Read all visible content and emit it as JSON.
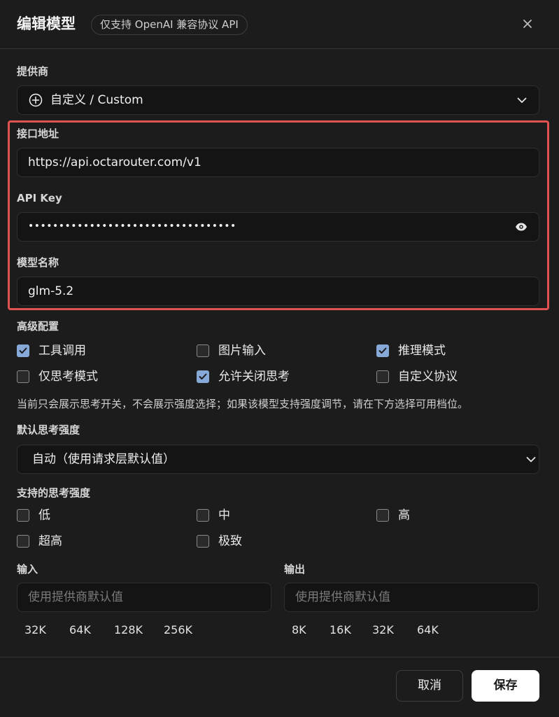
{
  "dialog": {
    "title": "编辑模型",
    "subtitle": "仅支持 OpenAI 兼容协议 API"
  },
  "provider": {
    "label": "提供商",
    "value": "自定义 / Custom"
  },
  "endpoint": {
    "label": "接口地址",
    "value": "https://api.octarouter.com/v1"
  },
  "api_key": {
    "label": "API Key",
    "masked_value": "••••••••••••••••••••••••••••••••••"
  },
  "model_name": {
    "label": "模型名称",
    "value": "glm-5.2"
  },
  "advanced": {
    "label": "高级配置",
    "options": [
      {
        "label": "工具调用",
        "checked": true
      },
      {
        "label": "图片输入",
        "checked": false
      },
      {
        "label": "推理模式",
        "checked": true
      },
      {
        "label": "仅思考模式",
        "checked": false
      },
      {
        "label": "允许关闭思考",
        "checked": true
      },
      {
        "label": "自定义协议",
        "checked": false
      }
    ],
    "hint": "当前只会展示思考开关，不会展示强度选择；如果该模型支持强度调节，请在下方选择可用档位。"
  },
  "default_effort": {
    "label": "默认思考强度",
    "value": "自动（使用请求层默认值）"
  },
  "supported_effort": {
    "label": "支持的思考强度",
    "options": [
      {
        "label": "低",
        "checked": false
      },
      {
        "label": "中",
        "checked": false
      },
      {
        "label": "高",
        "checked": false
      },
      {
        "label": "超高",
        "checked": false
      },
      {
        "label": "极致",
        "checked": false
      }
    ]
  },
  "input_tokens": {
    "label": "输入",
    "placeholder": "使用提供商默认值",
    "presets": [
      "32K",
      "64K",
      "128K",
      "256K"
    ]
  },
  "output_tokens": {
    "label": "输出",
    "placeholder": "使用提供商默认值",
    "presets": [
      "8K",
      "16K",
      "32K",
      "64K"
    ]
  },
  "footer": {
    "cancel_label": "取消",
    "save_label": "保存"
  },
  "colors": {
    "background": "#1c1c1c",
    "field_background": "#141414",
    "checkbox_checked": "#86a9d8",
    "highlight_border": "#e05252",
    "save_button": "#ffffff"
  }
}
